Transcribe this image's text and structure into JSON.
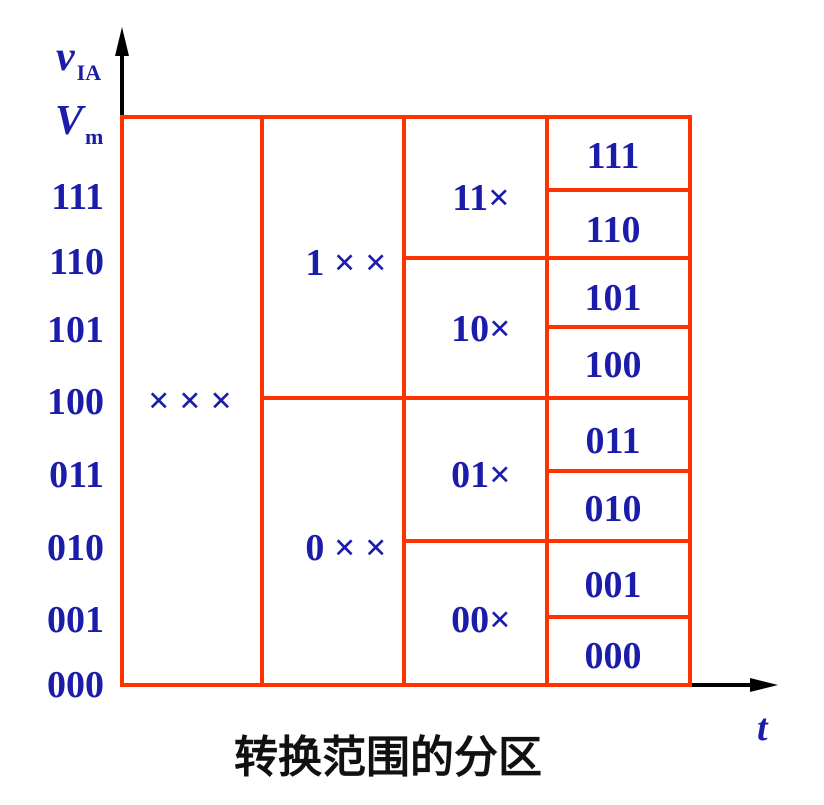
{
  "axes": {
    "y_label": {
      "symbol": "v",
      "subscript": "IA"
    },
    "y_max_label": {
      "symbol": "V",
      "subscript": "m"
    },
    "x_label": "t",
    "y_ticks": [
      "111",
      "110",
      "101",
      "100",
      "011",
      "010",
      "001",
      "000"
    ]
  },
  "partition": {
    "level1": [
      "× × ×"
    ],
    "level2": [
      "1 × ×",
      "0 × ×"
    ],
    "level3": [
      "11×",
      "10×",
      "01×",
      "00×"
    ],
    "level4": [
      "111",
      "110",
      "101",
      "100",
      "011",
      "010",
      "001",
      "000"
    ]
  },
  "caption": "转换范围的分区",
  "colors": {
    "grid": "#ff3300",
    "label": "#1c1caa",
    "axis": "#000000",
    "caption": "#111111"
  }
}
